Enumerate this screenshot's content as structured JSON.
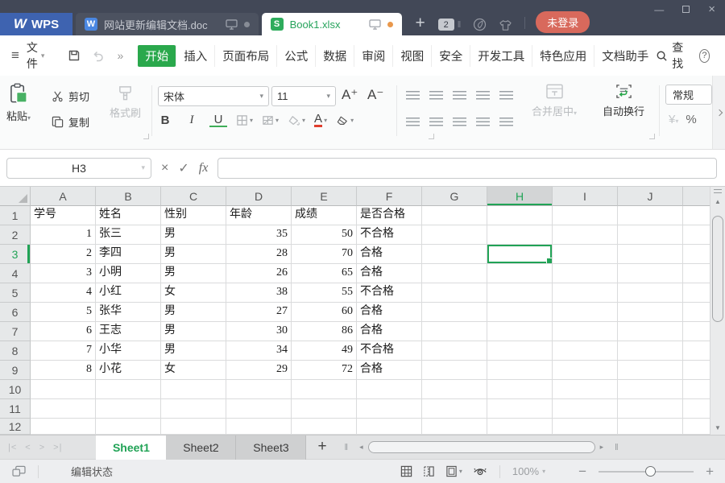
{
  "colors": {
    "accent_green": "#21a356",
    "start_tab_green": "#2aa84c",
    "active_doc_green": "#26a35b",
    "wps_blue": "#3e63b0",
    "writer_icon_blue": "#4a87e2",
    "et_icon_green": "#2eac5c",
    "login_red": "#d8695c",
    "dot_orange": "#e9984c",
    "titlebar_dark": "#424857",
    "font_color_red": "#e03e2d"
  },
  "glyphs": {
    "hamburger": "≡",
    "chevron_down": "▾",
    "more": "»",
    "plus": "+",
    "minus": "−",
    "close": "×",
    "check": "✓",
    "dots": "⋮",
    "pipe": "‖",
    "minimize": "—",
    "up_arrow": "▲",
    "down_arrow": "▼",
    "left_arrow": "◂",
    "right_arrow": "▸"
  },
  "titlebar": {
    "logo_letter": "W",
    "logo_text": "WPS",
    "tabs": [
      {
        "icon_letter": "W",
        "label": "网站更新编辑文档.doc"
      },
      {
        "icon_letter": "S",
        "label": "Book1.xlsx"
      }
    ],
    "tab_count": "2",
    "login_label": "未登录"
  },
  "menubar": {
    "file_label": "文件",
    "tabs": [
      "开始",
      "插入",
      "页面布局",
      "公式",
      "数据",
      "审阅",
      "视图",
      "安全",
      "开发工具",
      "特色应用",
      "文档助手"
    ],
    "active_tab": "开始",
    "find_label": "查找",
    "help_label": "?"
  },
  "ribbon": {
    "paste": "粘贴",
    "cut": "剪切",
    "copy": "复制",
    "format_painter": "格式刷",
    "font_name": "宋体",
    "font_size": "11",
    "grow_font": "A⁺",
    "shrink_font": "A⁻",
    "bold": "B",
    "italic": "I",
    "underline": "U",
    "font_color_letter": "A",
    "merge_center": "合并居中",
    "wrap_text": "自动换行",
    "number_format": "常规",
    "currency": "¥",
    "percent": "%"
  },
  "formula_bar": {
    "name_box": "H3",
    "fx_label": "fx",
    "formula_value": ""
  },
  "grid": {
    "columns": [
      "A",
      "B",
      "C",
      "D",
      "E",
      "F",
      "G",
      "H",
      "I",
      "J"
    ],
    "selected_column": "H",
    "selected_row": 3,
    "selected_cell": "H3",
    "rows": [
      {
        "n": 1,
        "cells": [
          "学号",
          "姓名",
          "性别",
          "年龄",
          "成绩",
          "是否合格"
        ]
      },
      {
        "n": 2,
        "cells": [
          "1",
          "张三",
          "男",
          "35",
          "50",
          "不合格"
        ]
      },
      {
        "n": 3,
        "cells": [
          "2",
          "李四",
          "男",
          "28",
          "70",
          "合格"
        ]
      },
      {
        "n": 4,
        "cells": [
          "3",
          "小明",
          "男",
          "26",
          "65",
          "合格"
        ]
      },
      {
        "n": 5,
        "cells": [
          "4",
          "小红",
          "女",
          "38",
          "55",
          "不合格"
        ]
      },
      {
        "n": 6,
        "cells": [
          "5",
          "张华",
          "男",
          "27",
          "60",
          "合格"
        ]
      },
      {
        "n": 7,
        "cells": [
          "6",
          "王志",
          "男",
          "30",
          "86",
          "合格"
        ]
      },
      {
        "n": 8,
        "cells": [
          "7",
          "小华",
          "男",
          "34",
          "49",
          "不合格"
        ]
      },
      {
        "n": 9,
        "cells": [
          "8",
          "小花",
          "女",
          "29",
          "72",
          "合格"
        ]
      },
      {
        "n": 10,
        "cells": []
      },
      {
        "n": 11,
        "cells": []
      },
      {
        "n": 12,
        "cells": []
      }
    ]
  },
  "sheetbar": {
    "nav": [
      "|<",
      "<",
      ">",
      ">|"
    ],
    "tabs": [
      {
        "label": "Sheet1",
        "active": true
      },
      {
        "label": "Sheet2",
        "active": false
      },
      {
        "label": "Sheet3",
        "active": false
      }
    ],
    "add_label": "+"
  },
  "statusbar": {
    "mode_label": "编辑状态",
    "zoom_level": "100%"
  }
}
